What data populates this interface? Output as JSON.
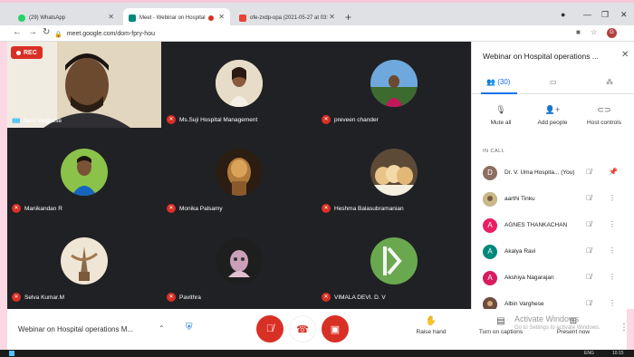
{
  "browser": {
    "tabs": [
      {
        "label": "(29) WhatsApp",
        "favicon_color": "#25d366"
      },
      {
        "label": "Meet - Webinar on Hospital",
        "favicon_color": "#00897b"
      },
      {
        "label": "ofe-zxdp-opa (2021-05-27 at 03:",
        "favicon_color": "#ea4335"
      }
    ],
    "new_tab": "+",
    "url": "meet.google.com/dom-fpry-hou",
    "profile_initial": "G"
  },
  "meeting": {
    "rec_label": "REC",
    "tiles": [
      {
        "name": "Sam Varghese",
        "kind": "camera"
      },
      {
        "name": "Ms.Suji Hospital Management",
        "kind": "photo",
        "bg": "#e8d8c0"
      },
      {
        "name": "preveen chander",
        "kind": "photo",
        "bg": "#5b9bd5"
      },
      {
        "name": "Manikandan R",
        "kind": "photo",
        "bg": "#7fbf6a"
      },
      {
        "name": "Monika Palsamy",
        "kind": "photo",
        "bg": "#3b2a1a"
      },
      {
        "name": "Heshma Balasubramanian",
        "kind": "photo",
        "bg": "#c8a878"
      },
      {
        "name": "Selva Kumar.M",
        "kind": "photo",
        "bg": "#c9b79c"
      },
      {
        "name": "Pavithra",
        "kind": "photo",
        "bg": "#2a2a2a"
      },
      {
        "name": "VIMALA DEVI. D. V",
        "kind": "photo",
        "bg": "#6aa84f"
      }
    ]
  },
  "bottom": {
    "meeting_title": "Webinar on Hospital operations M...",
    "raise_hand": "Raise hand",
    "captions": "Turn on captions",
    "present": "Present now",
    "watermark_title": "Activate Windows",
    "watermark_sub": "Go to Settings to activate Windows."
  },
  "panel": {
    "title": "Webinar on Hospital operations ...",
    "people_count": "(30)",
    "mute_all": "Mute all",
    "add_people": "Add people",
    "host_controls": "Host controls",
    "in_call": "IN CALL",
    "people": [
      {
        "name": "Dr. V. Uma Hospita...   (You)",
        "initial": "D",
        "color": "#8d6e63"
      },
      {
        "name": "aarthi Tinku",
        "initial": "",
        "color": "#a1887f"
      },
      {
        "name": "AGNES THANKACHAN",
        "initial": "A",
        "color": "#e91e63"
      },
      {
        "name": "Akalya Ravi",
        "initial": "A",
        "color": "#00897b"
      },
      {
        "name": "Akshiya Nagarajan",
        "initial": "A",
        "color": "#d81b60"
      },
      {
        "name": "Albin Varghese",
        "initial": "",
        "color": "#795548"
      }
    ]
  },
  "taskbar": {
    "lang": "ENG",
    "time": "10:15"
  }
}
